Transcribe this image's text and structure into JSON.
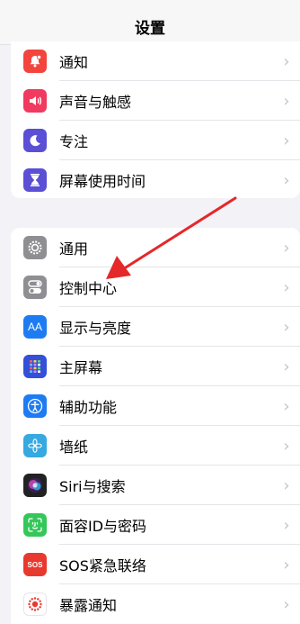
{
  "nav": {
    "title": "设置"
  },
  "group1": [
    {
      "label": "通知",
      "icon": "bell-icon",
      "color": "#f2453d"
    },
    {
      "label": "声音与触感",
      "icon": "speaker-icon",
      "color": "#f03a5f"
    },
    {
      "label": "专注",
      "icon": "moon-icon",
      "color": "#5b4fd6"
    },
    {
      "label": "屏幕使用时间",
      "icon": "hourglass-icon",
      "color": "#5b4fd6"
    }
  ],
  "group2": [
    {
      "label": "通用",
      "icon": "gear-icon",
      "color": "#8e8e93"
    },
    {
      "label": "控制中心",
      "icon": "toggles-icon",
      "color": "#8e8e93"
    },
    {
      "label": "显示与亮度",
      "icon": "text-size-icon",
      "color": "#1e7cf2"
    },
    {
      "label": "主屏幕",
      "icon": "home-grid-icon",
      "color": "#3450d8"
    },
    {
      "label": "辅助功能",
      "icon": "accessibility-icon",
      "color": "#1e7cf2"
    },
    {
      "label": "墙纸",
      "icon": "flower-icon",
      "color": "#36a9e0"
    },
    {
      "label": "Siri与搜索",
      "icon": "siri-icon",
      "color": "#222222"
    },
    {
      "label": "面容ID与密码",
      "icon": "face-id-icon",
      "color": "#35c759"
    },
    {
      "label": "SOS紧急联络",
      "icon": "sos-icon",
      "color": "#e8392f"
    },
    {
      "label": "暴露通知",
      "icon": "exposure-icon",
      "color": "#ffffff"
    }
  ],
  "icon_text": {
    "text_size": "AA",
    "sos": "SOS"
  },
  "chevron": "›",
  "annotation": {
    "color": "#e5282a"
  }
}
